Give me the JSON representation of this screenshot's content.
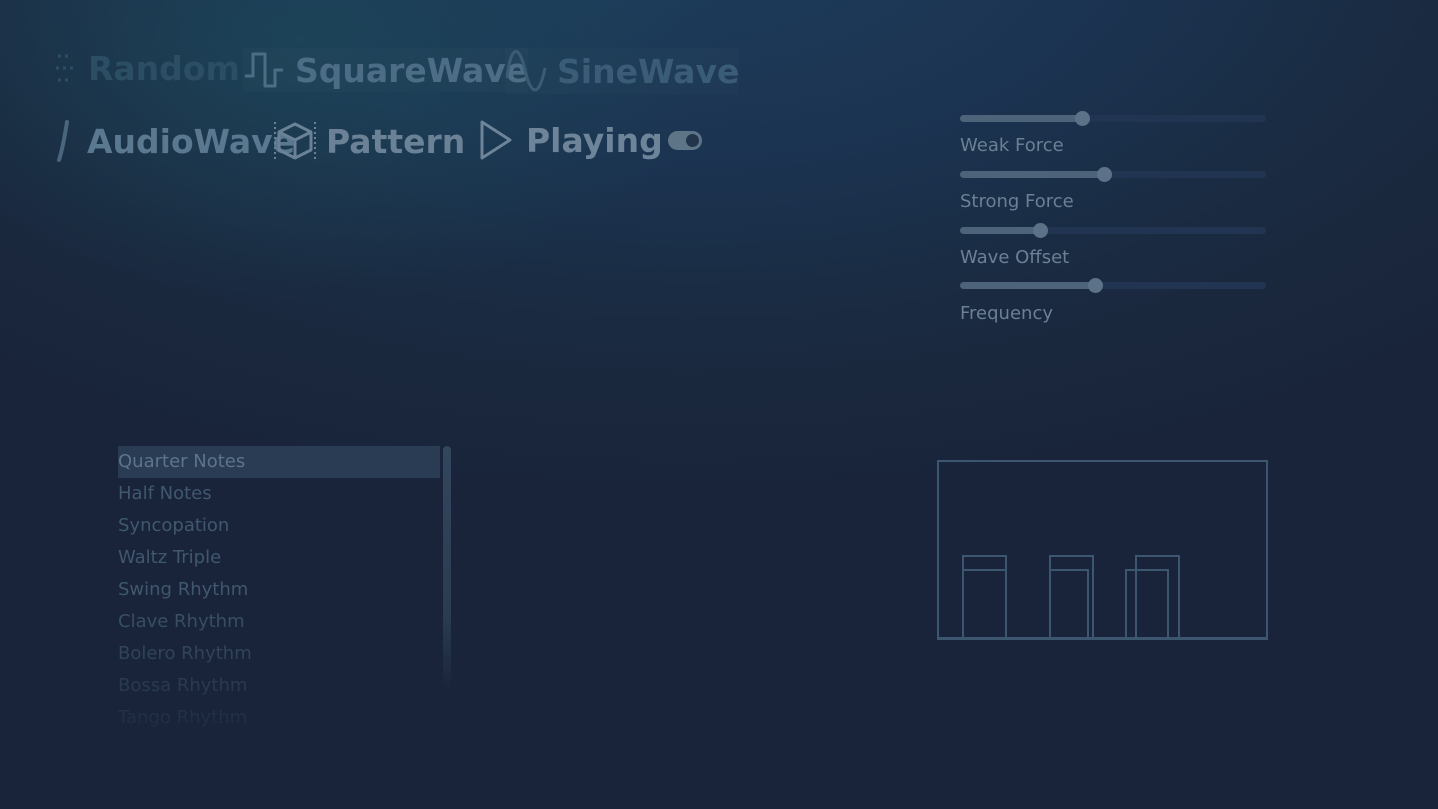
{
  "toolbar": {
    "modes": [
      {
        "label": "Random",
        "icon": "random-icon"
      },
      {
        "label": "SquareWave",
        "icon": "square-wave-icon"
      },
      {
        "label": "SineWave",
        "icon": "sine-wave-icon"
      },
      {
        "label": "AudioWave",
        "icon": "audio-wave-icon"
      },
      {
        "label": "Pattern",
        "icon": "cube-icon"
      },
      {
        "label": "Playing",
        "icon": "play-icon"
      }
    ],
    "toggle_on": true
  },
  "sliders": [
    {
      "label": "",
      "value": 0.4
    },
    {
      "label": "Weak Force",
      "value": 0.47
    },
    {
      "label": "Strong Force",
      "value": 0.26
    },
    {
      "label": "Wave Offset",
      "value": 0.44
    },
    {
      "label": "Frequency",
      "value": null
    }
  ],
  "pattern_list": {
    "items": [
      "Quarter Notes",
      "Half Notes",
      "Syncopation",
      "Waltz Triple",
      "Swing Rhythm",
      "Clave Rhythm",
      "Bolero Rhythm",
      "Bossa Rhythm",
      "Tango Rhythm"
    ],
    "selected_index": 0
  },
  "colors": {
    "accent": "#5c7288",
    "background": "#1b2b42",
    "preview_stroke": "#3d5670"
  }
}
